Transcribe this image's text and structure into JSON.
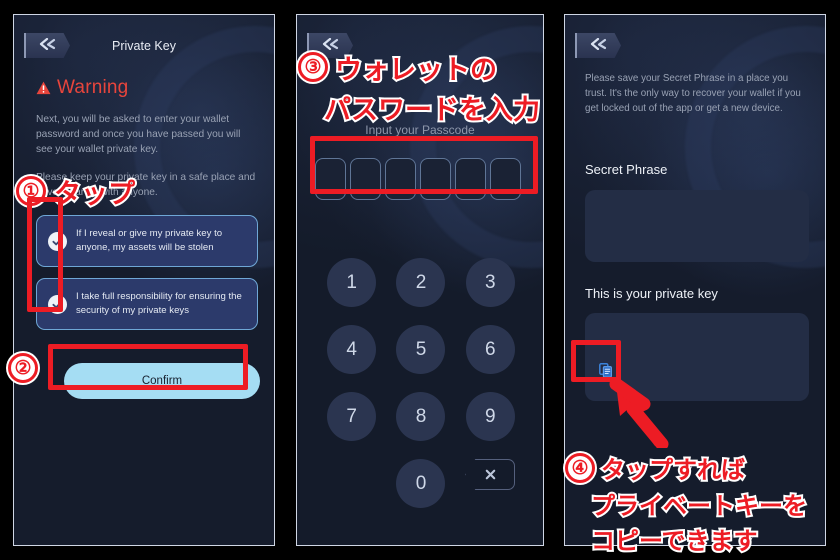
{
  "panel1": {
    "back_icon": "back-chevrons-icon",
    "title": "Private Key",
    "warning_icon": "warning-triangle-icon",
    "warning_label": "Warning",
    "paragraph1": "Next, you will be asked to enter your wallet password and once you have passed you will see your wallet private key.",
    "paragraph2": "Please keep your private key in a safe place and never share it with anyone.",
    "checkbox1": {
      "icon": "check-circle-icon",
      "label": "If I reveal or give my private key to anyone, my assets will be stolen",
      "checked": true
    },
    "checkbox2": {
      "icon": "check-circle-icon",
      "label": "I take full responsibility for ensuring the security of my private keys",
      "checked": true
    },
    "confirm_label": "Confirm"
  },
  "panel2": {
    "back_icon": "back-chevrons-icon",
    "passcode_label": "Input your Passcode",
    "pin_cells": 6,
    "keys": [
      "1",
      "2",
      "3",
      "4",
      "5",
      "6",
      "7",
      "8",
      "9",
      "",
      "0",
      "backspace"
    ],
    "backspace_icon": "backspace-x-icon"
  },
  "panel3": {
    "back_icon": "back-chevrons-icon",
    "paragraph": "Please save your Secret Phrase in a place you trust. It's the only way to recover your wallet if you get locked out of the app or get a new device.",
    "secret_phrase_heading": "Secret Phrase",
    "secret_phrase_value": "",
    "private_key_heading": "This is your private key",
    "private_key_value": "",
    "copy_icon": "copy-icon"
  },
  "annotations": {
    "step1_number": "①",
    "step1_text": "タップ",
    "step2_number": "②",
    "step3_number": "③",
    "step3_line1": "ウォレットの",
    "step3_line2": "パスワードを入力",
    "step4_number": "④",
    "step4_line1": "タップすれば",
    "step4_line2": "プライベートキーを",
    "step4_line3": "コピーできます",
    "accent_color": "#ed1c24"
  }
}
